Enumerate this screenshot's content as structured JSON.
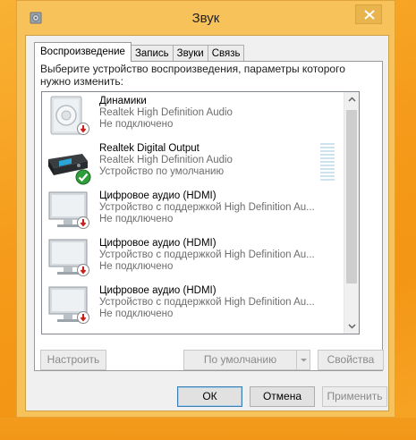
{
  "window": {
    "title": "Звук",
    "icon": "speaker-icon",
    "close_icon": "close-icon"
  },
  "tabs": [
    {
      "label": "Воспроизведение",
      "active": true
    },
    {
      "label": "Запись",
      "active": false
    },
    {
      "label": "Звуки",
      "active": false
    },
    {
      "label": "Связь",
      "active": false
    }
  ],
  "instruction": "Выберите устройство воспроизведения, параметры которого нужно изменить:",
  "devices": [
    {
      "name": "Динамики",
      "driver": "Realtek High Definition Audio",
      "status": "Не подключено",
      "icon": "speaker-icon",
      "badge": "disconnected-badge-icon"
    },
    {
      "name": "Realtek Digital Output",
      "driver": "Realtek High Definition Audio",
      "status": "Устройство по умолчанию",
      "icon": "digital-output-icon",
      "badge": "default-checkmark-icon"
    },
    {
      "name": "Цифровое аудио (HDMI)",
      "driver": "Устройство с поддержкой High Definition Au...",
      "status": "Не подключено",
      "icon": "monitor-icon",
      "badge": "disconnected-badge-icon"
    },
    {
      "name": "Цифровое аудио (HDMI)",
      "driver": "Устройство с поддержкой High Definition Au...",
      "status": "Не подключено",
      "icon": "monitor-icon",
      "badge": "disconnected-badge-icon"
    },
    {
      "name": "Цифровое аудио (HDMI)",
      "driver": "Устройство с поддержкой High Definition Au...",
      "status": "Не подключено",
      "icon": "monitor-icon",
      "badge": "disconnected-badge-icon"
    }
  ],
  "buttons": {
    "configure": "Настроить",
    "set_default": "По умолчанию",
    "properties": "Свойства",
    "ok": "ОК",
    "cancel": "Отмена",
    "apply": "Применить"
  },
  "colors": {
    "desktop": "#f7a21b",
    "window_frame": "#f8c25a",
    "ok_green": "#2f9e3a",
    "disconnected_red": "#c8201b"
  }
}
